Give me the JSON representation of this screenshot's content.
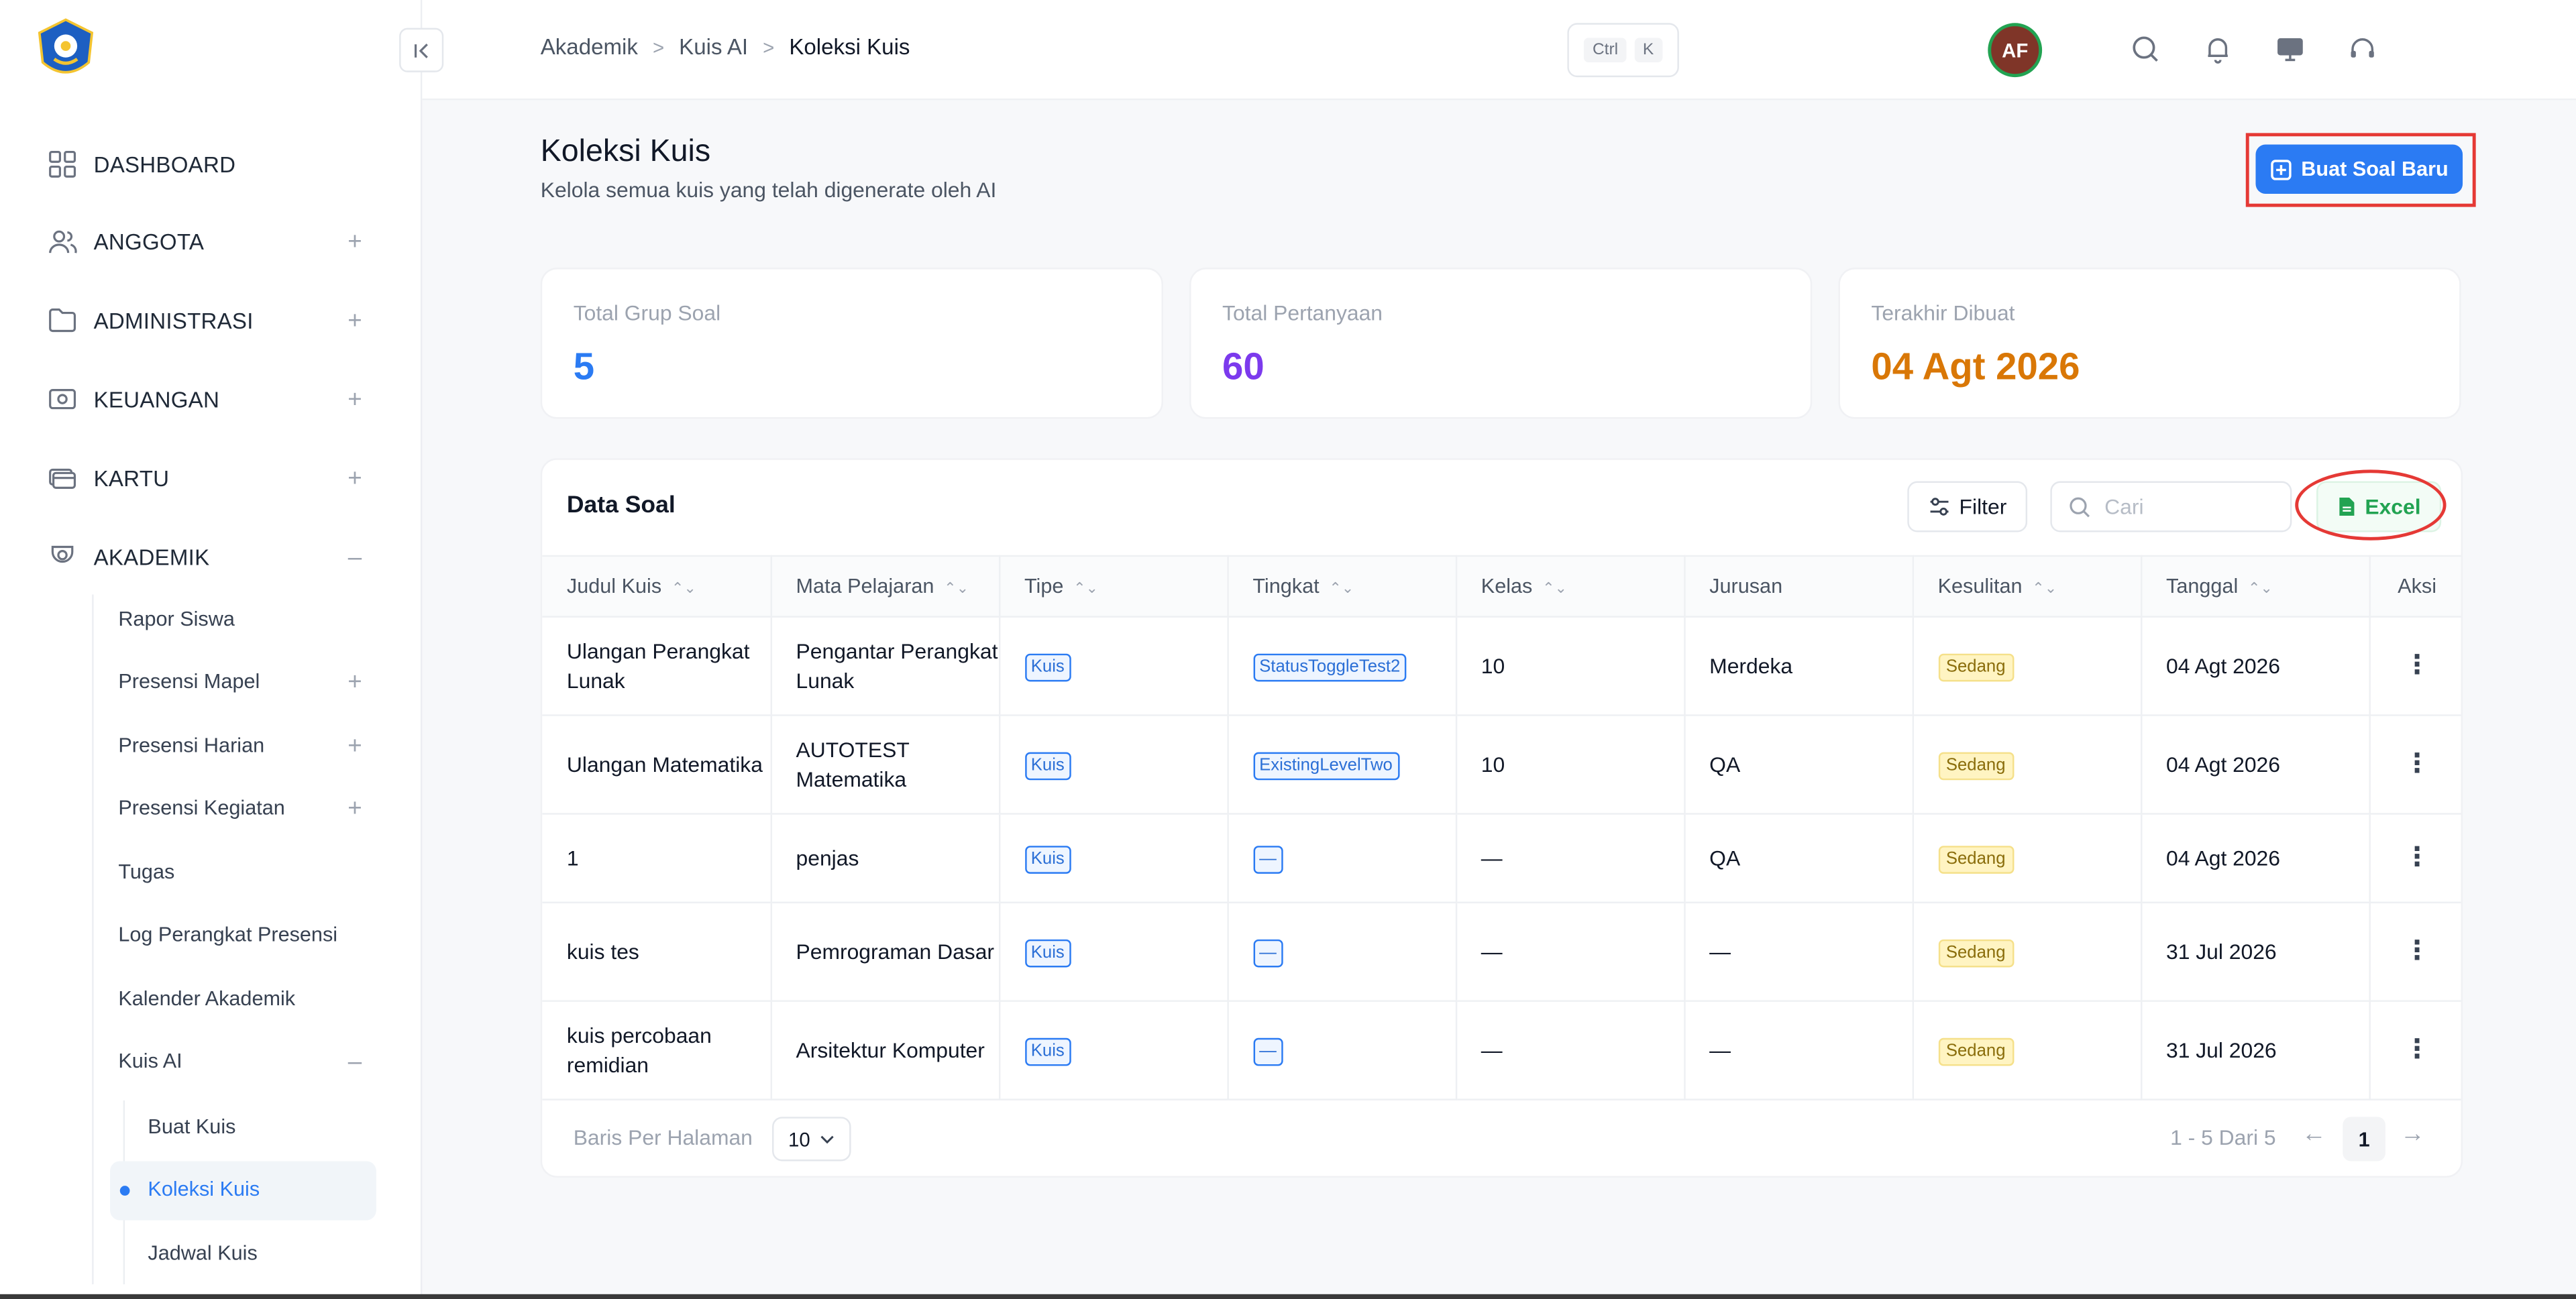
{
  "sidebar": {
    "items": [
      {
        "label": "DASHBOARD",
        "icon": "grid-icon",
        "toggle": ""
      },
      {
        "label": "ANGGOTA",
        "icon": "users-icon",
        "toggle": "+"
      },
      {
        "label": "ADMINISTRASI",
        "icon": "folder-icon",
        "toggle": "+"
      },
      {
        "label": "KEUANGAN",
        "icon": "money-icon",
        "toggle": "+"
      },
      {
        "label": "KARTU",
        "icon": "card-icon",
        "toggle": "+"
      },
      {
        "label": "AKADEMIK",
        "icon": "academic-icon",
        "toggle": "–"
      }
    ],
    "akademik_items": [
      {
        "label": "Rapor Siswa",
        "toggle": ""
      },
      {
        "label": "Presensi Mapel",
        "toggle": "+"
      },
      {
        "label": "Presensi Harian",
        "toggle": "+"
      },
      {
        "label": "Presensi Kegiatan",
        "toggle": "+"
      },
      {
        "label": "Tugas",
        "toggle": ""
      },
      {
        "label": "Log Perangkat Presensi",
        "toggle": ""
      },
      {
        "label": "Kalender Akademik",
        "toggle": ""
      },
      {
        "label": "Kuis AI",
        "toggle": "–"
      }
    ],
    "kuis_items": [
      "Buat Kuis",
      "Koleksi Kuis",
      "Jadwal Kuis"
    ]
  },
  "header": {
    "breadcrumb": [
      "Akademik",
      "Kuis AI",
      "Koleksi Kuis"
    ],
    "shortcut": [
      "Ctrl",
      "K"
    ],
    "avatar": "AF"
  },
  "page": {
    "title": "Koleksi Kuis",
    "subtitle": "Kelola semua kuis yang telah digenerate oleh AI",
    "create_button": "Buat Soal Baru"
  },
  "stats": [
    {
      "label": "Total Grup Soal",
      "value": "5",
      "color": "#2b7bf3"
    },
    {
      "label": "Total Pertanyaan",
      "value": "60",
      "color": "#7c3aed"
    },
    {
      "label": "Terakhir Dibuat",
      "value": "04 Agt 2026",
      "color": "#d97706"
    }
  ],
  "table": {
    "title": "Data Soal",
    "filter_label": "Filter",
    "search_placeholder": "Cari",
    "excel_label": "Excel",
    "columns": [
      "Judul Kuis",
      "Mata Pelajaran",
      "Tipe",
      "Tingkat",
      "Kelas",
      "Jurusan",
      "Kesulitan",
      "Tanggal",
      "Aksi"
    ],
    "rows": [
      {
        "judul": "Ulangan Perangkat Lunak",
        "mapel": "Pengantar Perangkat Lunak",
        "tipe": "Kuis",
        "tingkat": "StatusToggleTest2",
        "kelas": "10",
        "jurusan": "Merdeka",
        "kesulitan": "Sedang",
        "tanggal": "04 Agt 2026"
      },
      {
        "judul": "Ulangan Matematika",
        "mapel": "AUTOTEST Matematika",
        "tipe": "Kuis",
        "tingkat": "ExistingLevelTwo",
        "kelas": "10",
        "jurusan": "QA",
        "kesulitan": "Sedang",
        "tanggal": "04 Agt 2026"
      },
      {
        "judul": "1",
        "mapel": "penjas",
        "tipe": "Kuis",
        "tingkat": "—",
        "kelas": "—",
        "jurusan": "QA",
        "kesulitan": "Sedang",
        "tanggal": "04 Agt 2026"
      },
      {
        "judul": "kuis tes",
        "mapel": "Pemrograman Dasar",
        "tipe": "Kuis",
        "tingkat": "—",
        "kelas": "—",
        "jurusan": "—",
        "kesulitan": "Sedang",
        "tanggal": "31 Jul 2026"
      },
      {
        "judul": "kuis percobaan remidian",
        "mapel": "Arsitektur Komputer",
        "tipe": "Kuis",
        "tingkat": "—",
        "kelas": "—",
        "jurusan": "—",
        "kesulitan": "Sedang",
        "tanggal": "31 Jul 2026"
      }
    ],
    "rows_per_page_label": "Baris Per Halaman",
    "rows_per_page": "10",
    "range_text": "1 - 5 Dari 5",
    "current_page": "1"
  }
}
